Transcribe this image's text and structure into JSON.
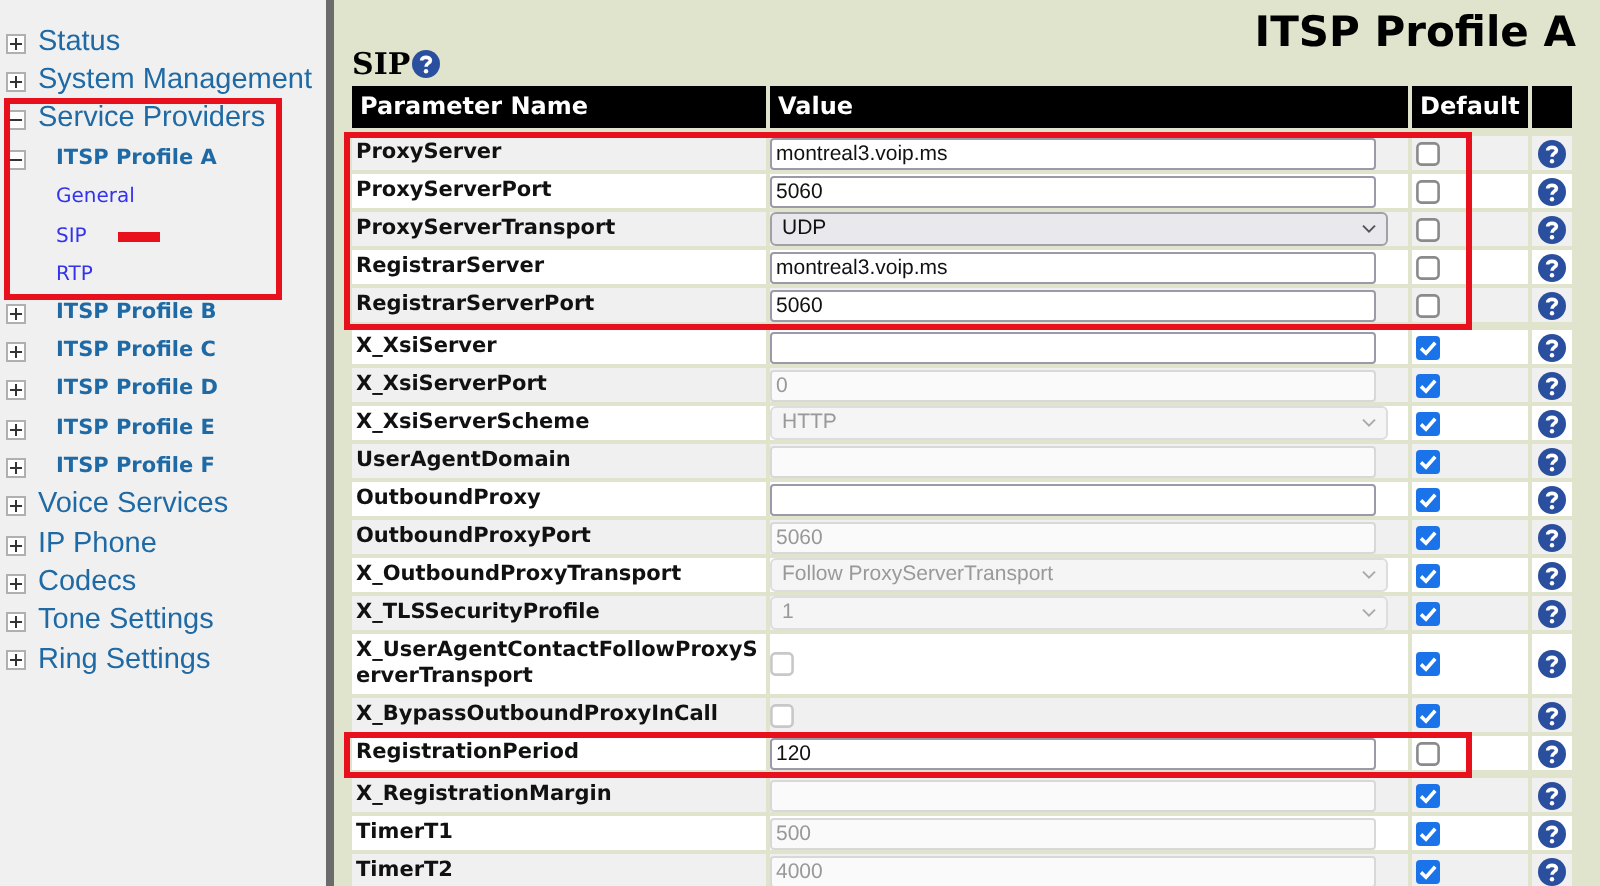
{
  "sidebar": {
    "items": [
      {
        "label": "Status",
        "expanded": false
      },
      {
        "label": "System Management",
        "expanded": false
      },
      {
        "label": "Service Providers",
        "expanded": true,
        "highlighted": true,
        "children": [
          {
            "label": "ITSP Profile A",
            "expanded": true,
            "highlighted": true,
            "children": [
              {
                "label": "General",
                "highlighted": true
              },
              {
                "label": "SIP",
                "highlighted": true,
                "marked": true
              },
              {
                "label": "RTP",
                "highlighted": true
              }
            ]
          },
          {
            "label": "ITSP Profile B",
            "expanded": false
          },
          {
            "label": "ITSP Profile C",
            "expanded": false
          },
          {
            "label": "ITSP Profile D",
            "expanded": false
          },
          {
            "label": "ITSP Profile E",
            "expanded": false
          },
          {
            "label": "ITSP Profile F",
            "expanded": false
          }
        ]
      },
      {
        "label": "Voice Services",
        "expanded": false
      },
      {
        "label": "IP Phone",
        "expanded": false
      },
      {
        "label": "Codecs",
        "expanded": false
      },
      {
        "label": "Tone Settings",
        "expanded": false
      },
      {
        "label": "Ring Settings",
        "expanded": false
      }
    ]
  },
  "page_title": "ITSP Profile A",
  "section_title": "SIP",
  "table": {
    "columns": [
      "Parameter Name",
      "Value",
      "Default"
    ],
    "rows": [
      {
        "name": "ProxyServer",
        "kind": "text",
        "value": "montreal3.voip.ms",
        "disabled": false,
        "default": false,
        "highlighted": true
      },
      {
        "name": "ProxyServerPort",
        "kind": "text",
        "value": "5060",
        "disabled": false,
        "default": false,
        "highlighted": true
      },
      {
        "name": "ProxyServerTransport",
        "kind": "select",
        "value": "UDP",
        "disabled": false,
        "default": false,
        "highlighted": true
      },
      {
        "name": "RegistrarServer",
        "kind": "text",
        "value": "montreal3.voip.ms",
        "disabled": false,
        "default": false,
        "highlighted": true
      },
      {
        "name": "RegistrarServerPort",
        "kind": "text",
        "value": "5060",
        "disabled": false,
        "default": false,
        "highlighted": true
      },
      {
        "name": "X_XsiServer",
        "kind": "text",
        "disabled": false,
        "default": true
      },
      {
        "name": "X_XsiServerPort",
        "kind": "text",
        "value": "0",
        "disabled": true,
        "default": true
      },
      {
        "name": "X_XsiServerScheme",
        "kind": "select",
        "value": "HTTP",
        "disabled": true,
        "default": true
      },
      {
        "name": "UserAgentDomain",
        "kind": "text",
        "disabled": true,
        "default": true
      },
      {
        "name": "OutboundProxy",
        "kind": "text",
        "disabled": false,
        "default": true
      },
      {
        "name": "OutboundProxyPort",
        "kind": "text",
        "value": "5060",
        "disabled": true,
        "default": true
      },
      {
        "name": "X_OutboundProxyTransport",
        "kind": "select",
        "value": "Follow ProxyServerTransport",
        "disabled": true,
        "default": true
      },
      {
        "name": "X_TLSSecurityProfile",
        "kind": "select",
        "value": "1",
        "disabled": true,
        "default": true
      },
      {
        "name": "X_UserAgentContactFollowProxyServerTransport",
        "kind": "checkbox",
        "checked": false,
        "disabled": true,
        "default": true
      },
      {
        "name": "X_BypassOutboundProxyInCall",
        "kind": "checkbox",
        "checked": false,
        "disabled": true,
        "default": true
      },
      {
        "name": "RegistrationPeriod",
        "kind": "text",
        "value": "120",
        "disabled": false,
        "default": false,
        "highlighted": true
      },
      {
        "name": "X_RegistrationMargin",
        "kind": "text",
        "disabled": true,
        "default": true
      },
      {
        "name": "TimerT1",
        "kind": "text",
        "value": "500",
        "disabled": true,
        "default": true
      },
      {
        "name": "TimerT2",
        "kind": "text",
        "value": "4000",
        "disabled": true,
        "default": true
      }
    ]
  }
}
